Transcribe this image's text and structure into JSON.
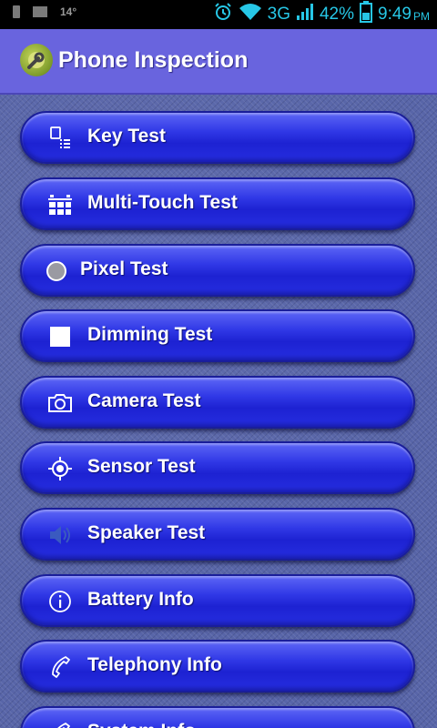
{
  "status_bar": {
    "temperature": "14°",
    "network": "3G",
    "battery": "42%",
    "time": "9:49",
    "ampm": "PM",
    "icons": [
      "phone-icon",
      "image-icon",
      "alarm-icon",
      "wifi-icon",
      "signal-icon",
      "battery-icon"
    ]
  },
  "app": {
    "title": "Phone Inspection",
    "icon": "android-wrench-icon"
  },
  "menu": {
    "items": [
      {
        "label": "Key Test",
        "icon": "keypad-icon"
      },
      {
        "label": "Multi-Touch Test",
        "icon": "grid-icon"
      },
      {
        "label": "Pixel Test",
        "icon": "circle-icon"
      },
      {
        "label": "Dimming Test",
        "icon": "square-icon"
      },
      {
        "label": "Camera Test",
        "icon": "camera-icon"
      },
      {
        "label": "Sensor Test",
        "icon": "target-icon"
      },
      {
        "label": "Speaker Test",
        "icon": "speaker-icon"
      },
      {
        "label": "Battery Info",
        "icon": "info-icon"
      },
      {
        "label": "Telephony Info",
        "icon": "phone-handset-icon"
      },
      {
        "label": "System Info",
        "icon": "phone-handset-icon"
      }
    ]
  },
  "colors": {
    "title_bar": "#6964de",
    "button": "#2a32e2",
    "status_text": "#27c7e6",
    "background": "#5865a8"
  }
}
